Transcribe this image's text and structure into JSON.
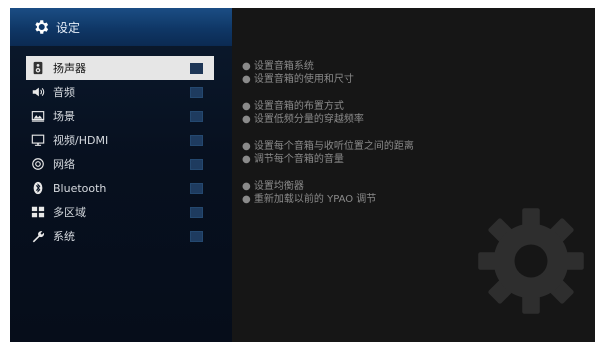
{
  "header": {
    "title": "设定",
    "icon": "gear-icon"
  },
  "menu": {
    "items": [
      {
        "label": "扬声器",
        "icon": "speaker-icon",
        "selected": true
      },
      {
        "label": "音频",
        "icon": "audio-icon"
      },
      {
        "label": "场景",
        "icon": "scene-icon"
      },
      {
        "label": "视频/HDMI",
        "icon": "video-hdmi-icon"
      },
      {
        "label": "网络",
        "icon": "network-icon"
      },
      {
        "label": "Bluetooth",
        "icon": "bluetooth-icon"
      },
      {
        "label": "多区域",
        "icon": "multi-zone-icon"
      },
      {
        "label": "系统",
        "icon": "wrench-icon"
      }
    ]
  },
  "help": {
    "group1": [
      "设置音箱系统",
      "设置音箱的使用和尺寸"
    ],
    "group2": [
      "设置音箱的布置方式",
      "设置低频分量的穿越频率"
    ],
    "group3": [
      "设置每个音箱与收听位置之间的距离",
      "调节每个音箱的音量"
    ],
    "group4": [
      "设置均衡器",
      "重新加载以前的 YPAO 调节"
    ]
  },
  "colors": {
    "header": "#134a82",
    "selected": "#e6e6e6",
    "background": "#161616"
  }
}
